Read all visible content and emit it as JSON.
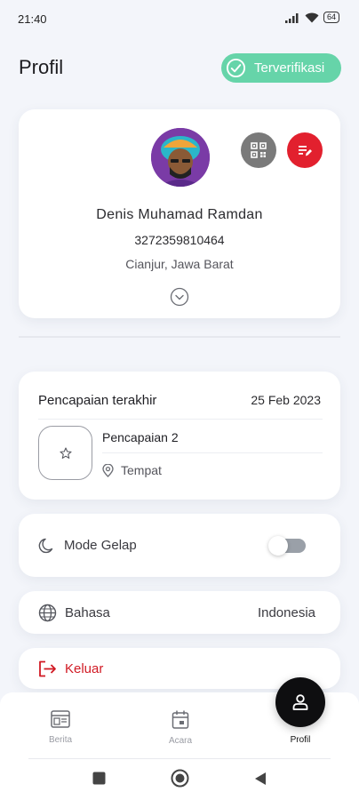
{
  "status_bar": {
    "time": "21:40",
    "battery": "64"
  },
  "header": {
    "title": "Profil",
    "verified_label": "Terverifikasi"
  },
  "profile": {
    "name": "Denis Muhamad Ramdan",
    "id_number": "3272359810464",
    "location": "Cianjur, Jawa Barat"
  },
  "achievement": {
    "section_title": "Pencapaian terakhir",
    "date": "25 Feb 2023",
    "name": "Pencapaian 2",
    "place": "Tempat"
  },
  "settings": {
    "dark_mode_label": "Mode Gelap",
    "dark_mode_enabled": false,
    "language_label": "Bahasa",
    "language_value": "Indonesia",
    "logout_label": "Keluar"
  },
  "bottom_nav": {
    "items": [
      {
        "label": "Berita",
        "icon": "news-icon"
      },
      {
        "label": "Acara",
        "icon": "calendar-icon"
      },
      {
        "label": "Profil",
        "icon": "person-icon",
        "active": true
      }
    ]
  },
  "colors": {
    "verified": "#66d4a9",
    "edit": "#e2202e",
    "qr": "#7a7a7a",
    "logout": "#d11a24",
    "fab": "#0e0e10"
  }
}
